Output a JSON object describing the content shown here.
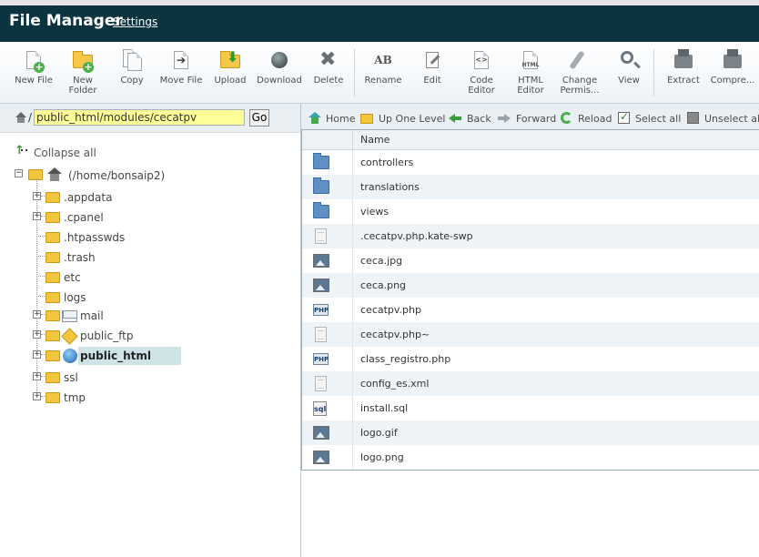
{
  "header": {
    "title": "File Manager",
    "settings": "Settings"
  },
  "toolbar": {
    "new_file": [
      "New File"
    ],
    "new_folder": [
      "New",
      "Folder"
    ],
    "copy": [
      "Copy"
    ],
    "move_file": [
      "Move File"
    ],
    "upload": [
      "Upload"
    ],
    "download": [
      "Download"
    ],
    "delete": [
      "Delete"
    ],
    "rename": [
      "Rename"
    ],
    "edit": [
      "Edit"
    ],
    "code_editor": [
      "Code",
      "Editor"
    ],
    "html_editor": [
      "HTML",
      "Editor"
    ],
    "change_perms": [
      "Change",
      "Permis..."
    ],
    "view": [
      "View"
    ],
    "extract": [
      "Extract"
    ],
    "compress": [
      "Compre..."
    ]
  },
  "left": {
    "path_value": "public_html/modules/cecatpv",
    "go": "Go",
    "collapse_all": "Collapse all",
    "root": "(/home/bonsaip2)",
    "tree": [
      {
        "label": ".appdata",
        "expand": true
      },
      {
        "label": ".cpanel",
        "expand": true
      },
      {
        "label": ".htpasswds",
        "expand": false
      },
      {
        "label": ".trash",
        "expand": false
      },
      {
        "label": "etc",
        "expand": false
      },
      {
        "label": "logs",
        "expand": false
      },
      {
        "label": "mail",
        "expand": true
      },
      {
        "label": "public_ftp",
        "expand": true
      },
      {
        "label": "public_html",
        "expand": true,
        "selected": true
      },
      {
        "label": "ssl",
        "expand": true
      },
      {
        "label": "tmp",
        "expand": true
      }
    ]
  },
  "nav": {
    "home": "Home",
    "up": "Up One Level",
    "back": "Back",
    "forward": "Forward",
    "reload": "Reload",
    "select_all": "Select all",
    "unselect_all": "Unselect all"
  },
  "table": {
    "header_name": "Name",
    "rows": [
      {
        "name": "controllers",
        "type": "folder"
      },
      {
        "name": "translations",
        "type": "folder"
      },
      {
        "name": "views",
        "type": "folder"
      },
      {
        "name": ".cecatpv.php.kate-swp",
        "type": "text"
      },
      {
        "name": "ceca.jpg",
        "type": "image"
      },
      {
        "name": "ceca.png",
        "type": "image"
      },
      {
        "name": "cecatpv.php",
        "type": "php"
      },
      {
        "name": "cecatpv.php~",
        "type": "text"
      },
      {
        "name": "class_registro.php",
        "type": "php"
      },
      {
        "name": "config_es.xml",
        "type": "text"
      },
      {
        "name": "install.sql",
        "type": "sql"
      },
      {
        "name": "logo.gif",
        "type": "image"
      },
      {
        "name": "logo.png",
        "type": "image"
      }
    ]
  },
  "icons": {
    "php_label": "PHP",
    "sql_label": "sql"
  }
}
